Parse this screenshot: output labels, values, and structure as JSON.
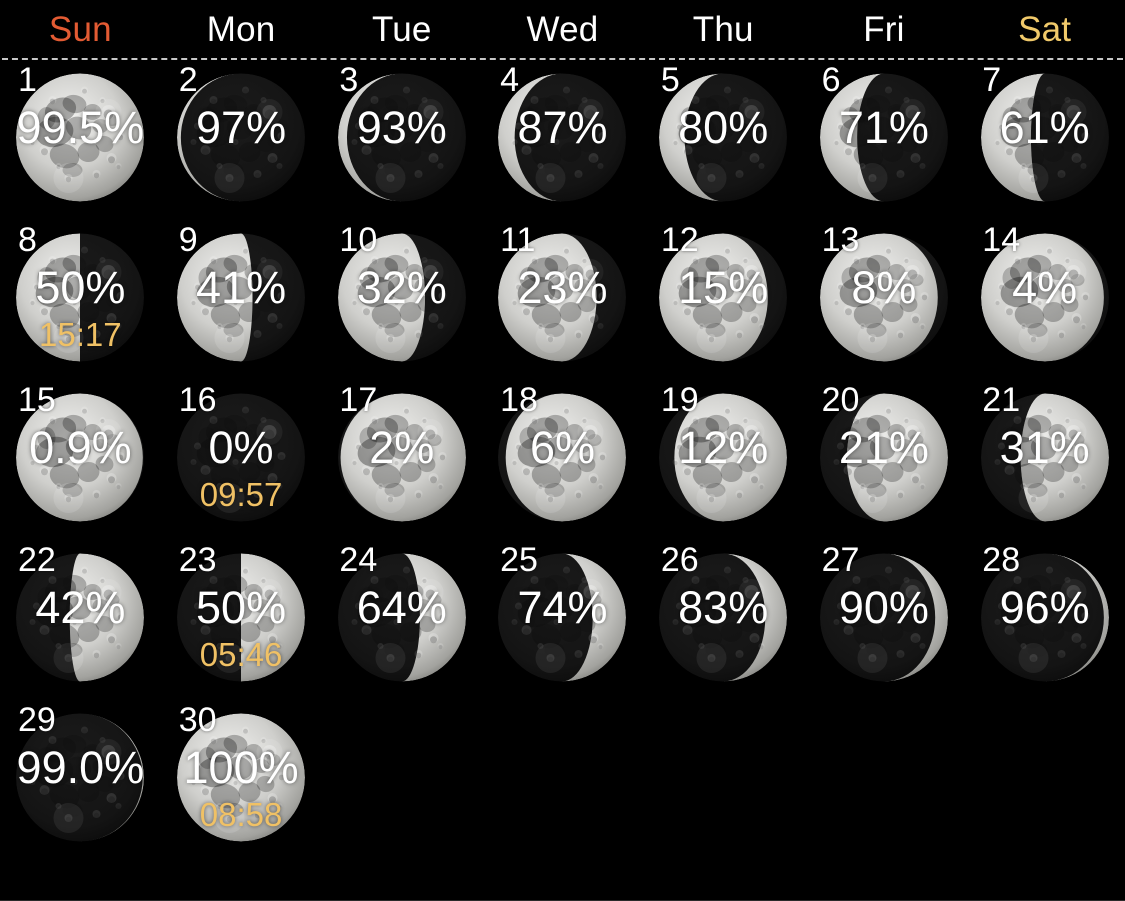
{
  "theme": {
    "background": "#000000",
    "weekday_default_color": "#ffffff",
    "sunday_color": "#e35b33",
    "saturday_color": "#f0c96a",
    "day_number_color": "#ffffff",
    "percent_color": "#ffffff",
    "event_time_color": "#f0c165",
    "separator_color": "#d8d8d8"
  },
  "header": {
    "weekdays": [
      {
        "label": "Sun",
        "color": "#e35b33"
      },
      {
        "label": "Mon",
        "color": "#ffffff"
      },
      {
        "label": "Tue",
        "color": "#ffffff"
      },
      {
        "label": "Wed",
        "color": "#ffffff"
      },
      {
        "label": "Thu",
        "color": "#ffffff"
      },
      {
        "label": "Fri",
        "color": "#ffffff"
      },
      {
        "label": "Sat",
        "color": "#f0c96a"
      }
    ]
  },
  "calendar": {
    "columns": 7,
    "rows": 5,
    "first_day_weekday_index": 0,
    "days": [
      {
        "day": "1",
        "illumination": "99.5%",
        "fraction": 0.995,
        "phase": "waning-gibbous",
        "lit_side": "left",
        "time": null
      },
      {
        "day": "2",
        "illumination": "97%",
        "fraction": 0.97,
        "phase": "waning-gibbous",
        "lit_side": "left",
        "time": null
      },
      {
        "day": "3",
        "illumination": "93%",
        "fraction": 0.93,
        "phase": "waning-gibbous",
        "lit_side": "left",
        "time": null
      },
      {
        "day": "4",
        "illumination": "87%",
        "fraction": 0.87,
        "phase": "waning-gibbous",
        "lit_side": "left",
        "time": null
      },
      {
        "day": "5",
        "illumination": "80%",
        "fraction": 0.8,
        "phase": "waning-gibbous",
        "lit_side": "left",
        "time": null
      },
      {
        "day": "6",
        "illumination": "71%",
        "fraction": 0.71,
        "phase": "waning-gibbous",
        "lit_side": "left",
        "time": null
      },
      {
        "day": "7",
        "illumination": "61%",
        "fraction": 0.61,
        "phase": "waning-gibbous",
        "lit_side": "left",
        "time": null
      },
      {
        "day": "8",
        "illumination": "50%",
        "fraction": 0.5,
        "phase": "last-quarter",
        "lit_side": "left",
        "time": "15:17"
      },
      {
        "day": "9",
        "illumination": "41%",
        "fraction": 0.41,
        "phase": "waning-crescent",
        "lit_side": "left",
        "time": null
      },
      {
        "day": "10",
        "illumination": "32%",
        "fraction": 0.32,
        "phase": "waning-crescent",
        "lit_side": "left",
        "time": null
      },
      {
        "day": "11",
        "illumination": "23%",
        "fraction": 0.23,
        "phase": "waning-crescent",
        "lit_side": "left",
        "time": null
      },
      {
        "day": "12",
        "illumination": "15%",
        "fraction": 0.15,
        "phase": "waning-crescent",
        "lit_side": "left",
        "time": null
      },
      {
        "day": "13",
        "illumination": "8%",
        "fraction": 0.08,
        "phase": "waning-crescent",
        "lit_side": "left",
        "time": null
      },
      {
        "day": "14",
        "illumination": "4%",
        "fraction": 0.04,
        "phase": "waning-crescent",
        "lit_side": "left",
        "time": null
      },
      {
        "day": "15",
        "illumination": "0.9%",
        "fraction": 0.009,
        "phase": "waning-crescent",
        "lit_side": "left",
        "time": null
      },
      {
        "day": "16",
        "illumination": "0%",
        "fraction": 0.0,
        "phase": "new-moon",
        "lit_side": "none",
        "time": "09:57"
      },
      {
        "day": "17",
        "illumination": "2%",
        "fraction": 0.02,
        "phase": "waxing-crescent",
        "lit_side": "right",
        "time": null
      },
      {
        "day": "18",
        "illumination": "6%",
        "fraction": 0.06,
        "phase": "waxing-crescent",
        "lit_side": "right",
        "time": null
      },
      {
        "day": "19",
        "illumination": "12%",
        "fraction": 0.12,
        "phase": "waxing-crescent",
        "lit_side": "right",
        "time": null
      },
      {
        "day": "20",
        "illumination": "21%",
        "fraction": 0.21,
        "phase": "waxing-crescent",
        "lit_side": "right",
        "time": null
      },
      {
        "day": "21",
        "illumination": "31%",
        "fraction": 0.31,
        "phase": "waxing-crescent",
        "lit_side": "right",
        "time": null
      },
      {
        "day": "22",
        "illumination": "42%",
        "fraction": 0.42,
        "phase": "waxing-crescent",
        "lit_side": "right",
        "time": null
      },
      {
        "day": "23",
        "illumination": "50%",
        "fraction": 0.5,
        "phase": "first-quarter",
        "lit_side": "right",
        "time": "05:46"
      },
      {
        "day": "24",
        "illumination": "64%",
        "fraction": 0.64,
        "phase": "waxing-gibbous",
        "lit_side": "right",
        "time": null
      },
      {
        "day": "25",
        "illumination": "74%",
        "fraction": 0.74,
        "phase": "waxing-gibbous",
        "lit_side": "right",
        "time": null
      },
      {
        "day": "26",
        "illumination": "83%",
        "fraction": 0.83,
        "phase": "waxing-gibbous",
        "lit_side": "right",
        "time": null
      },
      {
        "day": "27",
        "illumination": "90%",
        "fraction": 0.9,
        "phase": "waxing-gibbous",
        "lit_side": "right",
        "time": null
      },
      {
        "day": "28",
        "illumination": "96%",
        "fraction": 0.96,
        "phase": "waxing-gibbous",
        "lit_side": "right",
        "time": null
      },
      {
        "day": "29",
        "illumination": "99.0%",
        "fraction": 0.99,
        "phase": "waxing-gibbous",
        "lit_side": "right",
        "time": null
      },
      {
        "day": "30",
        "illumination": "100%",
        "fraction": 1.0,
        "phase": "full-moon",
        "lit_side": "both",
        "time": "08:58"
      }
    ]
  }
}
